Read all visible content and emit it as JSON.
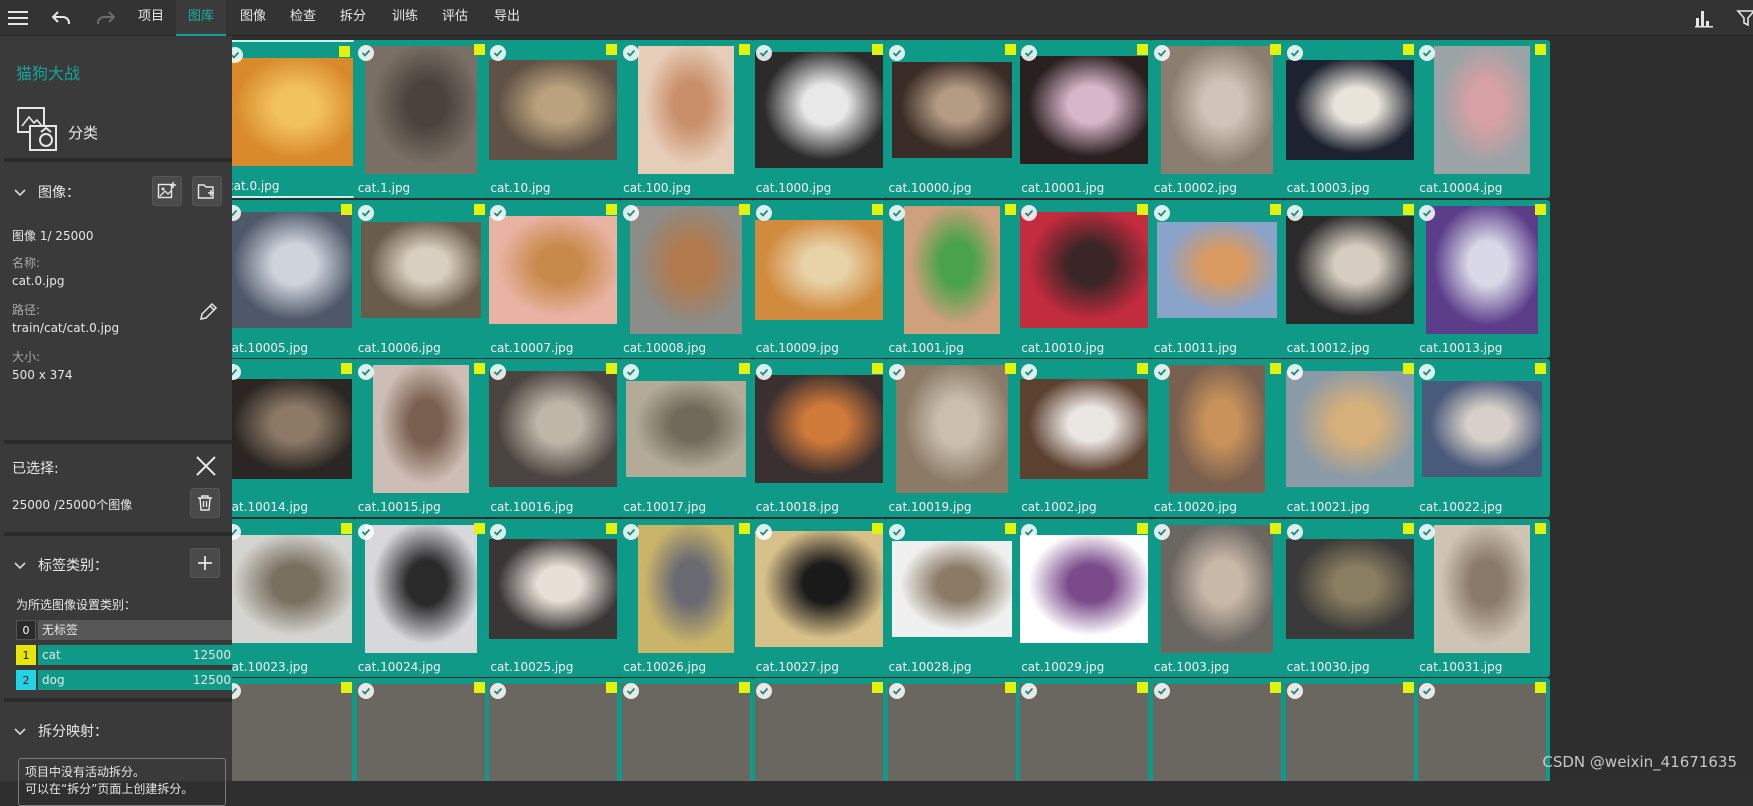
{
  "menu": {
    "items": [
      "项目",
      "图库",
      "图像",
      "检查",
      "拆分",
      "训练",
      "评估",
      "导出"
    ],
    "active": "图库"
  },
  "sidebar": {
    "project_name": "猫狗大战",
    "task_label": "分类",
    "images_section": {
      "title": "图像：",
      "index_text": "图像 1/ 25000",
      "name_label": "名称:",
      "name_value": "cat.0.jpg",
      "path_label": "路径:",
      "path_value": "train/cat/cat.0.jpg",
      "size_label": "大小:",
      "size_value": "500 x 374"
    },
    "selected_section": {
      "title": "已选择:",
      "count_text": "25000 /25000个图像"
    },
    "label_section": {
      "title": "标签类别：",
      "hint": "为所选图像设置类别：",
      "labels": [
        {
          "key": "0",
          "name": "无标签",
          "count": "",
          "key_color": "#2b2b2b",
          "bar_color": "#575757"
        },
        {
          "key": "1",
          "name": "cat",
          "count": "12500",
          "key_color": "#e8e40a",
          "bar_color": "#0f9a88"
        },
        {
          "key": "2",
          "name": "dog",
          "count": "12500",
          "key_color": "#22d3e6",
          "bar_color": "#0f9a88"
        }
      ]
    },
    "split_section": {
      "title": "拆分映射：",
      "note_line1": "项目中没有活动拆分。",
      "note_line2": "可以在“拆分”页面上创建拆分。"
    }
  },
  "gallery": {
    "tiles": [
      "cat.0.jpg",
      "cat.1.jpg",
      "cat.10.jpg",
      "cat.100.jpg",
      "cat.1000.jpg",
      "cat.10000.jpg",
      "cat.10001.jpg",
      "cat.10002.jpg",
      "cat.10003.jpg",
      "cat.10004.jpg",
      "cat.10005.jpg",
      "cat.10006.jpg",
      "cat.10007.jpg",
      "cat.10008.jpg",
      "cat.10009.jpg",
      "cat.1001.jpg",
      "cat.10010.jpg",
      "cat.10011.jpg",
      "cat.10012.jpg",
      "cat.10013.jpg",
      "cat.10014.jpg",
      "cat.10015.jpg",
      "cat.10016.jpg",
      "cat.10017.jpg",
      "cat.10018.jpg",
      "cat.10019.jpg",
      "cat.1002.jpg",
      "cat.10020.jpg",
      "cat.10021.jpg",
      "cat.10022.jpg",
      "cat.10023.jpg",
      "cat.10024.jpg",
      "cat.10025.jpg",
      "cat.10026.jpg",
      "cat.10027.jpg",
      "cat.10028.jpg",
      "cat.10029.jpg",
      "cat.1003.jpg",
      "cat.10030.jpg",
      "cat.10031.jpg"
    ]
  },
  "watermark": "CSDN @weixin_41671635",
  "colors": {
    "accent": "#17a398",
    "tile": "#0f9a88",
    "tag": "#e3f20a"
  }
}
